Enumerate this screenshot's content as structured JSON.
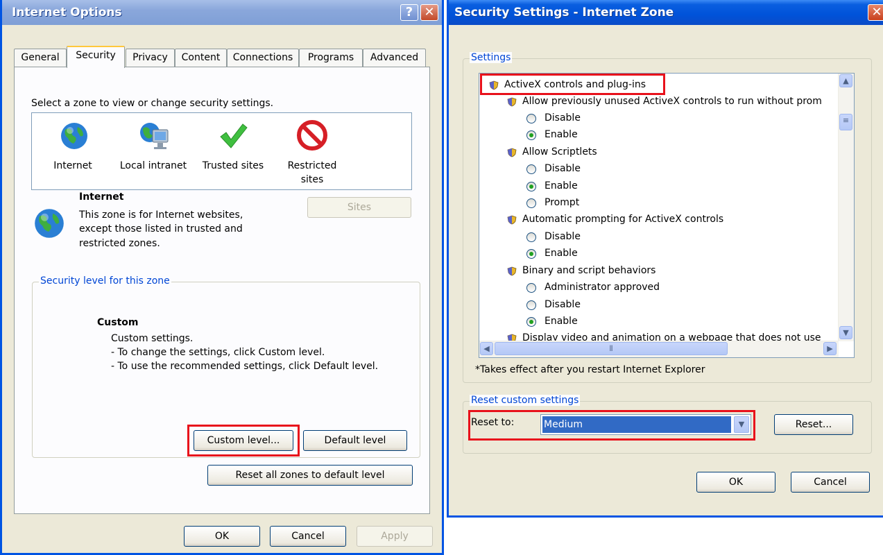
{
  "internet_options": {
    "title": "Internet Options",
    "help_glyph": "?",
    "close_glyph": "✕",
    "tabs": [
      {
        "label": "General"
      },
      {
        "label": "Security"
      },
      {
        "label": "Privacy"
      },
      {
        "label": "Content"
      },
      {
        "label": "Connections"
      },
      {
        "label": "Programs"
      },
      {
        "label": "Advanced"
      }
    ],
    "active_tab": "Security",
    "zone_prompt": "Select a zone to view or change security settings.",
    "zones": [
      {
        "label": "Internet",
        "icon": "globe-icon"
      },
      {
        "label": "Local intranet",
        "icon": "intranet-icon"
      },
      {
        "label": "Trusted sites",
        "icon": "checkmark-icon"
      },
      {
        "label": "Restricted sites",
        "icon": "restricted-icon"
      }
    ],
    "selected_zone": {
      "name": "Internet",
      "description_line1": "This zone is for Internet websites,",
      "description_line2": "except those listed in trusted and",
      "description_line3": "restricted zones."
    },
    "sites_button": "Sites",
    "security_level_group": "Security level for this zone",
    "level_name": "Custom",
    "level_desc_line1": "Custom settings.",
    "level_desc_line2": "- To change the settings, click Custom level.",
    "level_desc_line3": "- To use the recommended settings, click Default level.",
    "custom_level_button": "Custom level...",
    "default_level_button": "Default level",
    "reset_all_button": "Reset all zones to default level",
    "ok_button": "OK",
    "cancel_button": "Cancel",
    "apply_button": "Apply"
  },
  "security_settings": {
    "title": "Security Settings - Internet Zone",
    "close_glyph": "✕",
    "settings_group": "Settings",
    "tree": [
      {
        "type": "category",
        "label": "ActiveX controls and plug-ins"
      },
      {
        "type": "setting",
        "label": "Allow previously unused ActiveX controls to run without prom"
      },
      {
        "type": "option",
        "label": "Disable",
        "selected": false
      },
      {
        "type": "option",
        "label": "Enable",
        "selected": true
      },
      {
        "type": "setting",
        "label": "Allow Scriptlets"
      },
      {
        "type": "option",
        "label": "Disable",
        "selected": false
      },
      {
        "type": "option",
        "label": "Enable",
        "selected": true
      },
      {
        "type": "option",
        "label": "Prompt",
        "selected": false
      },
      {
        "type": "setting",
        "label": "Automatic prompting for ActiveX controls"
      },
      {
        "type": "option",
        "label": "Disable",
        "selected": false
      },
      {
        "type": "option",
        "label": "Enable",
        "selected": true
      },
      {
        "type": "setting",
        "label": "Binary and script behaviors"
      },
      {
        "type": "option",
        "label": "Administrator approved",
        "selected": false
      },
      {
        "type": "option",
        "label": "Disable",
        "selected": false
      },
      {
        "type": "option",
        "label": "Enable",
        "selected": true
      },
      {
        "type": "setting",
        "label": "Display video and animation on a webpage that does not use"
      }
    ],
    "footnote": "*Takes effect after you restart Internet Explorer",
    "reset_group": "Reset custom settings",
    "reset_to_label": "Reset to:",
    "reset_to_value": "Medium",
    "reset_button": "Reset...",
    "ok_button": "OK",
    "cancel_button": "Cancel"
  },
  "colors": {
    "highlight_box": "#e8111b",
    "selection": "#316ac5",
    "group_title": "#0046d5"
  }
}
